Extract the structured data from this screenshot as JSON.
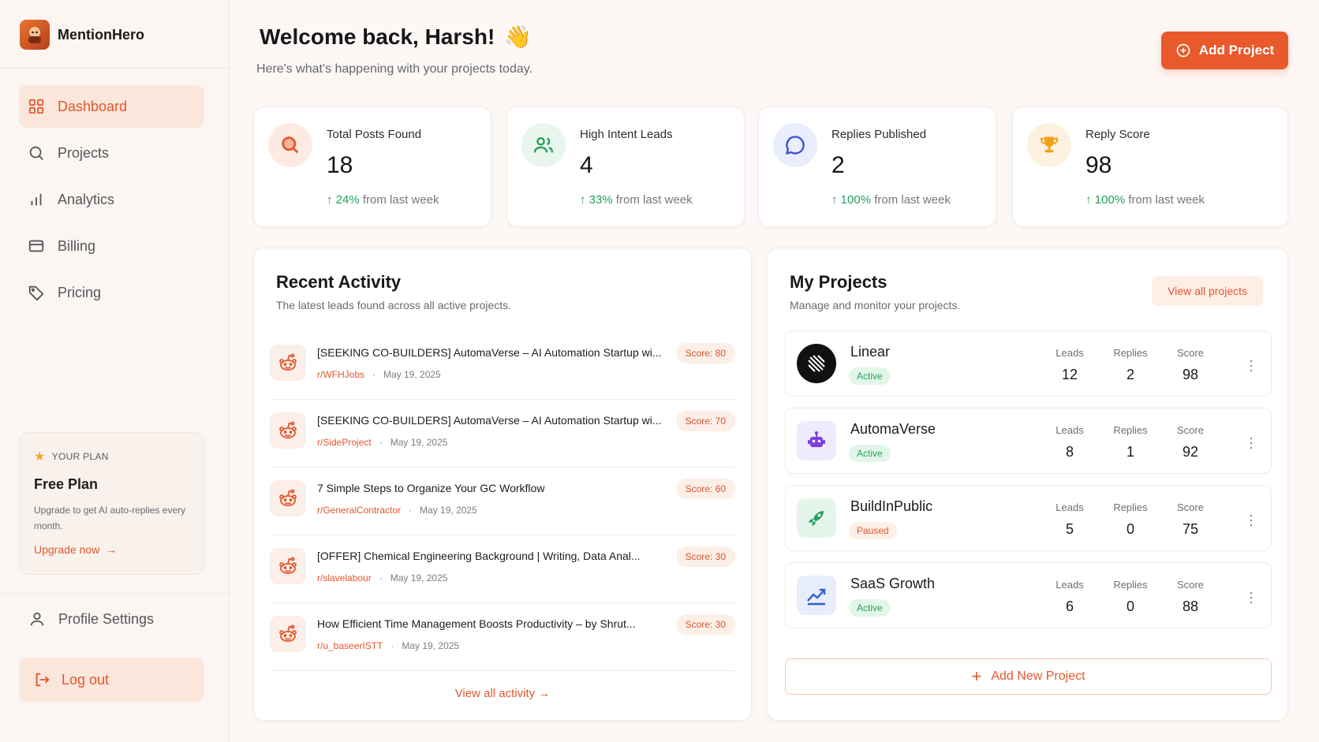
{
  "brand": {
    "name": "MentionHero",
    "logo_icon": "mascot-icon"
  },
  "sidebar": {
    "items": [
      {
        "label": "Dashboard",
        "icon": "grid-icon",
        "active": true
      },
      {
        "label": "Projects",
        "icon": "search-icon"
      },
      {
        "label": "Analytics",
        "icon": "bar-chart-icon"
      },
      {
        "label": "Billing",
        "icon": "credit-card-icon"
      },
      {
        "label": "Pricing",
        "icon": "tag-icon"
      }
    ],
    "plan": {
      "label": "YOUR PLAN",
      "name": "Free Plan",
      "description": "Upgrade to get AI auto-replies every month.",
      "link": "Upgrade now"
    },
    "profile": "Profile Settings",
    "logout": "Log out"
  },
  "header": {
    "title": "Welcome back, Harsh!",
    "emoji": "👋",
    "subtitle": "Here's what's happening with your projects today.",
    "add_button": "Add Project"
  },
  "stats": [
    {
      "title": "Total Posts Found",
      "value": "18",
      "pct": "24%",
      "suffix": "from last week",
      "icon": "search-icon",
      "color": "#e2572c"
    },
    {
      "title": "High Intent Leads",
      "value": "4",
      "pct": "33%",
      "suffix": "from last week",
      "icon": "users-icon",
      "color": "#23a05a"
    },
    {
      "title": "Replies Published",
      "value": "2",
      "pct": "100%",
      "suffix": "from last week",
      "icon": "chat-bubble-icon",
      "color": "#3b4fd8"
    },
    {
      "title": "Reply Score",
      "value": "98",
      "pct": "100%",
      "suffix": "from last week",
      "icon": "trophy-icon",
      "color": "#e89a1a"
    }
  ],
  "recent_activity": {
    "title": "Recent Activity",
    "subtitle": "The latest leads found across all active projects.",
    "items": [
      {
        "title": "[SEEKING CO-BUILDERS] AutomaVerse – AI Automation Startup wi...",
        "subreddit": "r/WFHJobs",
        "date": "May 19, 2025",
        "score": "Score: 80"
      },
      {
        "title": "[SEEKING CO-BUILDERS] AutomaVerse – AI Automation Startup wi...",
        "subreddit": "r/SideProject",
        "date": "May 19, 2025",
        "score": "Score: 70"
      },
      {
        "title": "7 Simple Steps to Organize Your GC Workflow",
        "subreddit": "r/GeneralContractor",
        "date": "May 19, 2025",
        "score": "Score: 60"
      },
      {
        "title": "[OFFER] Chemical Engineering Background | Writing, Data Anal...",
        "subreddit": "r/slavelabour",
        "date": "May 19, 2025",
        "score": "Score: 30"
      },
      {
        "title": "How Efficient Time Management Boosts Productivity – by Shrut...",
        "subreddit": "r/u_baseerISTT",
        "date": "May 19, 2025",
        "score": "Score: 30"
      }
    ],
    "view_all": "View all activity"
  },
  "my_projects": {
    "title": "My Projects",
    "subtitle": "Manage and monitor your projects.",
    "view_all": "View all projects",
    "col_leads": "Leads",
    "col_replies": "Replies",
    "col_score": "Score",
    "items": [
      {
        "name": "Linear",
        "status": "Active",
        "leads": "12",
        "replies": "2",
        "score": "98",
        "icon": "linear-logo-icon"
      },
      {
        "name": "AutomaVerse",
        "status": "Active",
        "leads": "8",
        "replies": "1",
        "score": "92",
        "icon": "robot-icon"
      },
      {
        "name": "BuildInPublic",
        "status": "Paused",
        "leads": "5",
        "replies": "0",
        "score": "75",
        "icon": "rocket-icon"
      },
      {
        "name": "SaaS Growth",
        "status": "Active",
        "leads": "6",
        "replies": "0",
        "score": "88",
        "icon": "trending-up-icon"
      }
    ],
    "add_new": "Add New Project"
  }
}
